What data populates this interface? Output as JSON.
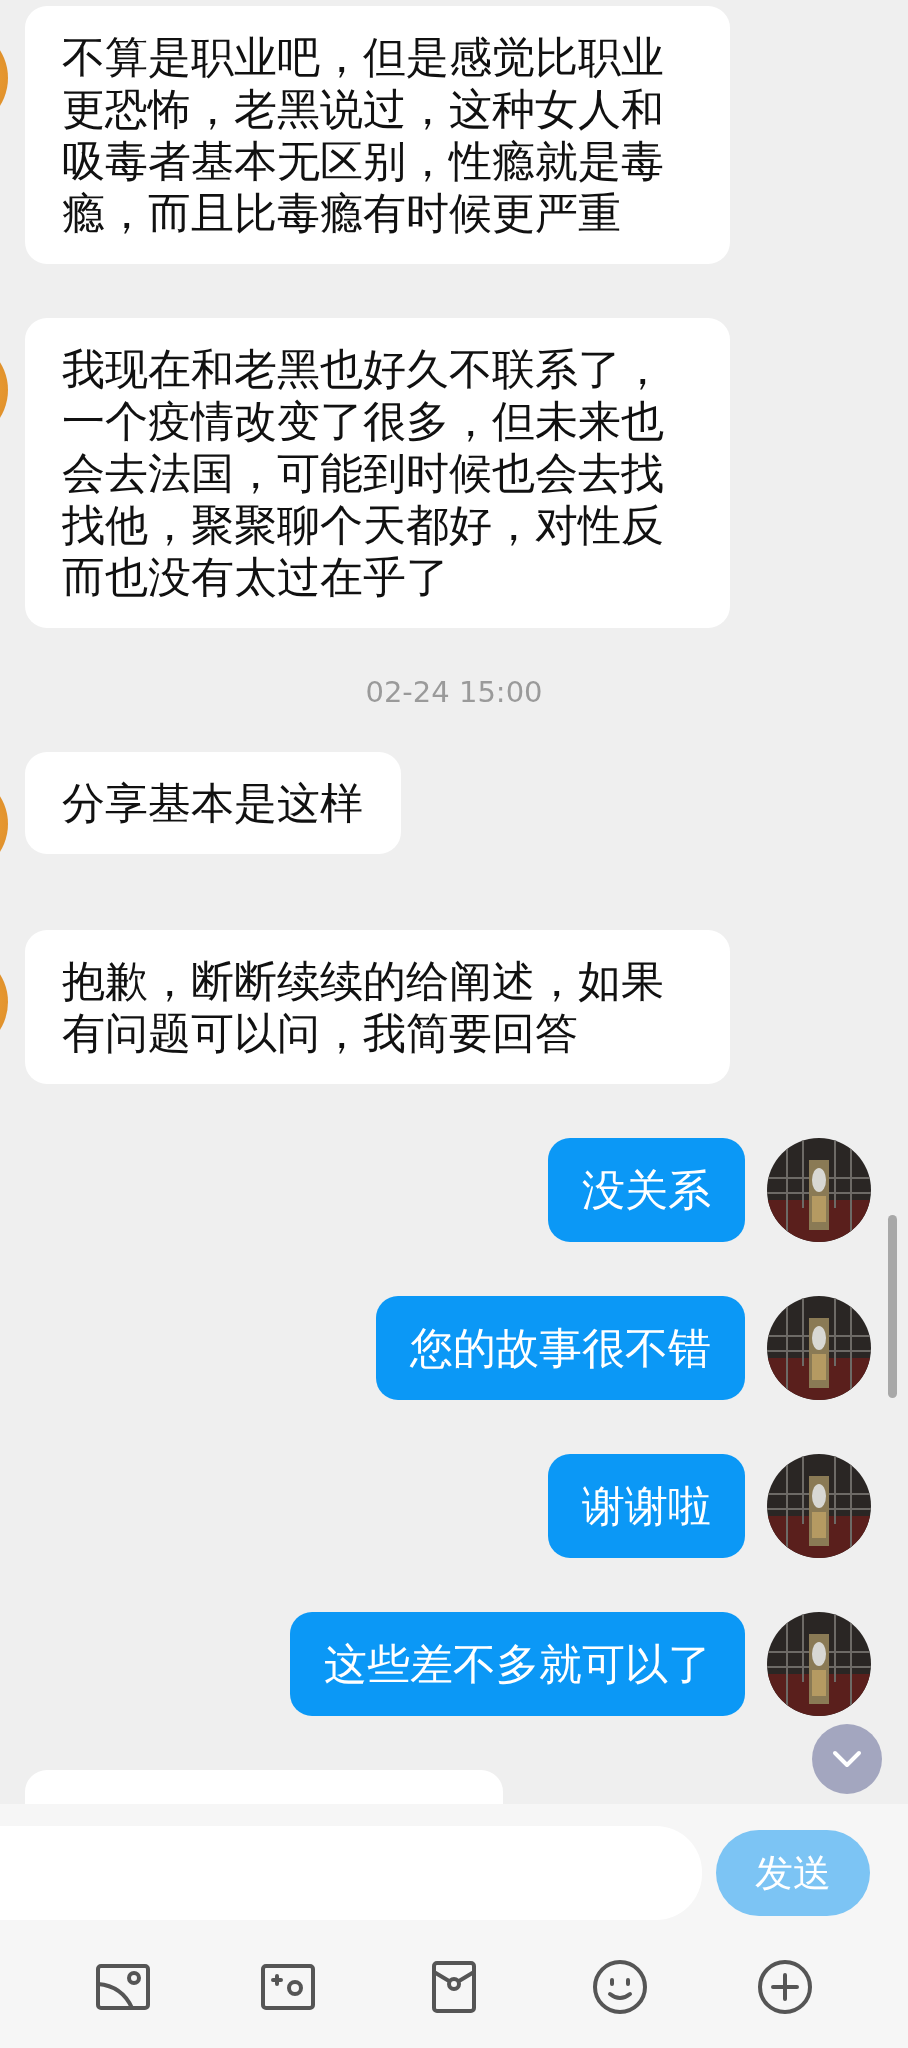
{
  "messages": [
    {
      "kind": "received",
      "text": "不算是职业吧，但是感觉比职业更恐怖，老黑说过，这种女人和吸毒者基本无区别，性瘾就是毒瘾，而且比毒瘾有时候更严重"
    },
    {
      "kind": "received",
      "text": "我现在和老黑也好久不联系了，一个疫情改变了很多，但未来也会去法国，可能到时候也会去找找他，聚聚聊个天都好，对性反而也没有太过在乎了"
    },
    {
      "kind": "time",
      "text": "02-24 15:00"
    },
    {
      "kind": "received",
      "text": "分享基本是这样"
    },
    {
      "kind": "received",
      "text": "抱歉，断断续续的给阐述，如果有问题可以问，我简要回答"
    },
    {
      "kind": "sent",
      "text": "没关系"
    },
    {
      "kind": "sent",
      "text": "您的故事很不错"
    },
    {
      "kind": "sent",
      "text": "谢谢啦"
    },
    {
      "kind": "sent",
      "text": "这些差不多就可以了"
    },
    {
      "kind": "received_cut"
    }
  ],
  "composer": {
    "send": {
      "label": "发送",
      "disabled": true
    }
  }
}
